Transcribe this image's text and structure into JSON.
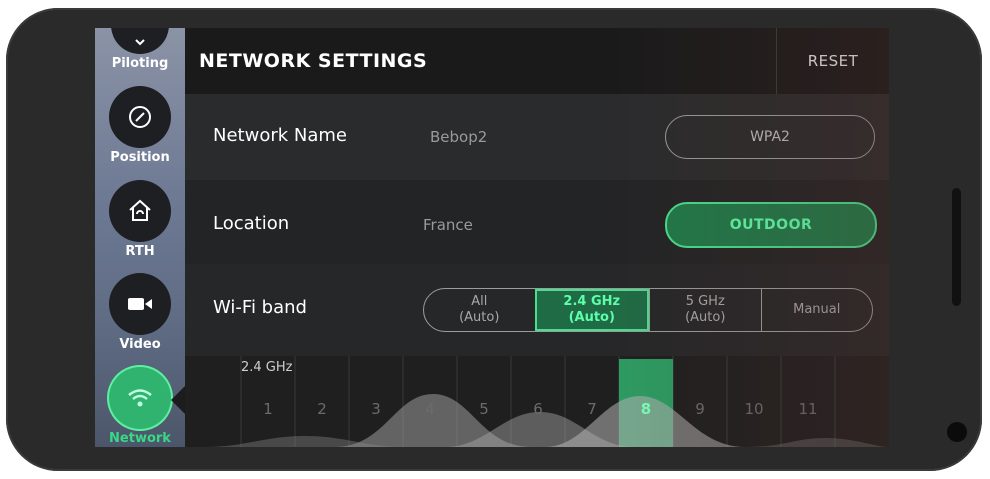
{
  "header": {
    "title": "NETWORK SETTINGS",
    "reset_label": "RESET"
  },
  "sidebar": {
    "items": [
      {
        "label": "Piloting",
        "icon": "chevron-down-icon",
        "active": false
      },
      {
        "label": "Position",
        "icon": "compass-icon",
        "active": false
      },
      {
        "label": "RTH",
        "icon": "home-return-icon",
        "active": false
      },
      {
        "label": "Video",
        "icon": "video-camera-icon",
        "active": false
      },
      {
        "label": "Network",
        "icon": "wifi-icon",
        "active": true
      }
    ]
  },
  "network_name": {
    "label": "Network Name",
    "value": "Bebop2",
    "security_button": "WPA2"
  },
  "location": {
    "label": "Location",
    "value": "France",
    "mode_button": "OUTDOOR"
  },
  "wifi_band": {
    "label": "Wi-Fi band",
    "options": [
      {
        "line1": "All",
        "line2": "(Auto)",
        "selected": false
      },
      {
        "line1": "2.4 GHz",
        "line2": "(Auto)",
        "selected": true
      },
      {
        "line1": "5 GHz",
        "line2": "(Auto)",
        "selected": false
      },
      {
        "line1": "Manual",
        "line2": "",
        "selected": false
      }
    ]
  },
  "channels": {
    "band_label": "2.4 GHz",
    "numbers": [
      "1",
      "2",
      "3",
      "4",
      "5",
      "6",
      "7",
      "8",
      "9",
      "10",
      "11"
    ],
    "selected": "8"
  },
  "colors": {
    "accent": "#2fb36f",
    "accent_text": "#5dffaa"
  }
}
